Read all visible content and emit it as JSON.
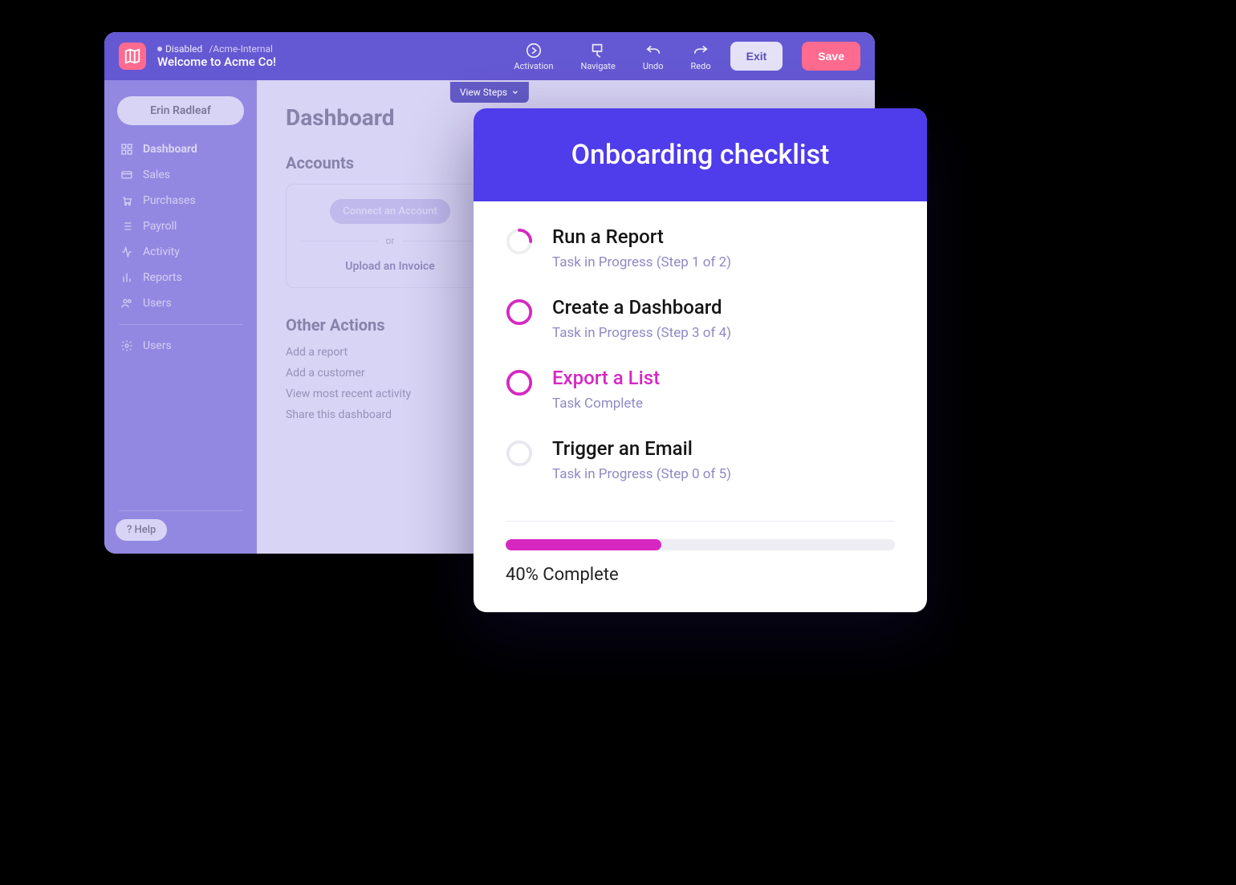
{
  "header": {
    "status": "Disabled",
    "path": "/Acme-Internal",
    "welcome": "Welcome to Acme Co!",
    "actions": {
      "activation": "Activation",
      "navigate": "Navigate",
      "undo": "Undo",
      "redo": "Redo"
    },
    "exit": "Exit",
    "save": "Save",
    "view_steps": "View Steps"
  },
  "sidebar": {
    "user": "Erin Radleaf",
    "items": [
      {
        "label": "Dashboard"
      },
      {
        "label": "Sales"
      },
      {
        "label": "Purchases"
      },
      {
        "label": "Payroll"
      },
      {
        "label": "Activity"
      },
      {
        "label": "Reports"
      },
      {
        "label": "Users"
      }
    ],
    "settings_item": "Users",
    "help": "? Help"
  },
  "main": {
    "title": "Dashboard",
    "accounts_heading": "Accounts",
    "connect_label": "Connect an Account",
    "or_label": "or",
    "upload_label": "Upload an Invoice",
    "other_heading": "Other Actions",
    "other_links": [
      "Add a report",
      "Add a customer",
      "View most recent activity",
      "Share this dashboard"
    ]
  },
  "panel": {
    "title": "Onboarding checklist",
    "tasks": [
      {
        "title": "Run a Report",
        "sub": "Task in Progress (Step 1 of 2)",
        "state": "partial"
      },
      {
        "title": "Create a Dashboard",
        "sub": "Task in Progress (Step 3 of 4)",
        "state": "open"
      },
      {
        "title": "Export a List",
        "sub": "Task Complete",
        "state": "complete"
      },
      {
        "title": "Trigger an Email",
        "sub": "Task in Progress (Step 0 of 5)",
        "state": "empty"
      }
    ],
    "progress_percent": 40,
    "progress_label": "40% Complete"
  }
}
